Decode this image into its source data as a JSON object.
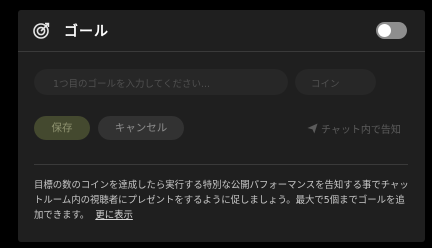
{
  "header": {
    "icon": "target-icon",
    "title": "ゴール",
    "toggle_on": false
  },
  "form": {
    "goal_placeholder": "1つ目のゴールを入力してください...",
    "coin_placeholder": "コイン",
    "save_label": "保存",
    "cancel_label": "キャンセル",
    "announce_label": "チャット内で告知",
    "announce_icon": "send-icon"
  },
  "description": {
    "text": "目標の数のコインを達成したら実行する特別な公開パフォーマンスを告知する事でチャットルーム内の視聴者にプレゼントをするように促しましょう。最大で5個までゴールを追加できます。",
    "more_link": "更に表示"
  },
  "colors": {
    "panel": "#1f1f1f",
    "save_button": "#44492f",
    "toggle_off": "#8e8e8e"
  }
}
